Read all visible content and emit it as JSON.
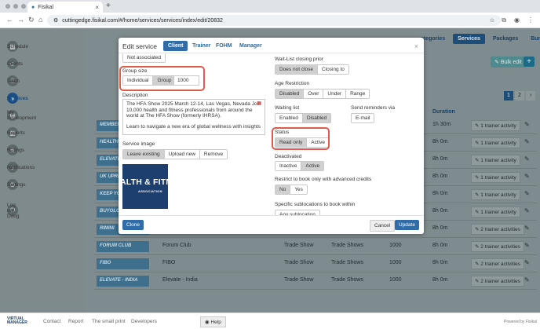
{
  "browser": {
    "tab_title": "Fisikal",
    "url": "cuttingedge.fisikal.com/#/home/services/services/index/edit/20832"
  },
  "sidebar": {
    "items": [
      {
        "label": "Schedule",
        "icon": "calendar-icon"
      },
      {
        "label": "Clients",
        "icon": "user-icon"
      },
      {
        "label": "Team",
        "icon": "team-icon"
      },
      {
        "label": "Services",
        "icon": "services-icon",
        "active": true
      },
      {
        "label": "My development",
        "icon": "development-icon"
      },
      {
        "label": "Reports",
        "icon": "reports-icon"
      },
      {
        "label": "Ratings",
        "icon": "star-icon"
      },
      {
        "label": "Notifications",
        "icon": "bell-icon"
      },
      {
        "label": "Settings",
        "icon": "gear-icon"
      },
      {
        "label": "Log out Doug",
        "icon": "logout-icon"
      }
    ]
  },
  "topnav": {
    "categories": "ategories",
    "services": "Services",
    "packages": "Packages",
    "bundles": "Bundles"
  },
  "toolbar": {
    "bulk_edit": "Bulk edit",
    "add": "+"
  },
  "pager": {
    "page1": "1",
    "page2": "2",
    "next": "›"
  },
  "table": {
    "duration_header": "Duration",
    "rows": [
      {
        "tag": "MEMBER",
        "type": "",
        "cat": "",
        "num": "",
        "duration": "1h 30m",
        "action": "1 trainer activity"
      },
      {
        "tag": "HEALTH",
        "type": "",
        "cat": "",
        "num": "",
        "duration": "8h 0m",
        "action": "1 trainer activity"
      },
      {
        "tag": "ELEVATE",
        "type": "",
        "cat": "",
        "num": "",
        "duration": "8h 0m",
        "action": "1 trainer activity"
      },
      {
        "tag": "UK UPRI",
        "type": "",
        "cat": "",
        "num": "",
        "duration": "8h 0m",
        "action": "1 trainer activity"
      },
      {
        "tag": "KEEP YO",
        "type": "",
        "cat": "",
        "num": "",
        "duration": "8h 0m",
        "action": "1 trainer activity"
      },
      {
        "tag": "BUYOLO",
        "type": "",
        "cat": "",
        "num": "",
        "duration": "8h 0m",
        "action": "1 trainer activity"
      },
      {
        "tag": "RIMINI",
        "type": "",
        "cat": "",
        "num": "",
        "duration": "8h 0m",
        "action": "2 trainer activities"
      },
      {
        "tag": "FORUM CLUB",
        "type": "Forum Club",
        "show": "Trade Show",
        "cat": "Trade Shows",
        "num": "1000",
        "duration": "8h 0m",
        "action": "2 trainer activities"
      },
      {
        "tag": "FIBO",
        "type": "FIBO",
        "show": "Trade Show",
        "cat": "Trade Shows",
        "num": "1000",
        "duration": "8h 0m",
        "action": "2 trainer activities"
      },
      {
        "tag": "ELEVATE - INDIA",
        "type": "Elevate - India",
        "show": "Trade Show",
        "cat": "Trade Shows",
        "num": "1000",
        "duration": "8h 0m",
        "action": "2 trainer activities"
      }
    ]
  },
  "footer": {
    "logo_line1": "VIRTUAL",
    "logo_line2": "MANAGER",
    "links": [
      "Contact",
      "Report",
      "The small print",
      "Developers"
    ],
    "help": "Help",
    "powered": "Powered by Fisikal"
  },
  "modal": {
    "title": "Edit service",
    "tabs": [
      "Client",
      "Trainer",
      "FOHM",
      "Manager"
    ],
    "not_associated": "Not associated",
    "group_size": {
      "label": "Group size",
      "options": [
        "Individual",
        "Group"
      ],
      "selected": "Group",
      "value": "1000"
    },
    "description": {
      "label": "Description",
      "text1": "The HFA Show 2025 March 12-14, Las Vegas, Nevada Join 10,000 health and fitness professionals from around the world at The HFA Show (formerly IHRSA).",
      "text2": "Learn to navigate a new era of global wellness with insights"
    },
    "service_image": {
      "label": "Service image",
      "options": [
        "Leave existing",
        "Upload new",
        "Remove"
      ],
      "selected": "Leave existing"
    },
    "image": {
      "big": "ALTH & FITN",
      "small": "ASSOCIATION"
    },
    "waitlist_closing": {
      "label": "Wait-List closing prior",
      "options": [
        "Does not close",
        "Closing to"
      ],
      "selected": "Does not close"
    },
    "age_restriction": {
      "label": "Age Restriction",
      "options": [
        "Disabled",
        "Over",
        "Under",
        "Range"
      ],
      "selected": "Disabled"
    },
    "waiting_list": {
      "label": "Waiting list",
      "options": [
        "Enabled",
        "Disabled"
      ],
      "selected": "Disabled"
    },
    "reminders": {
      "label": "Send reminders via",
      "options": [
        "E-mail"
      ]
    },
    "status": {
      "label": "Status",
      "options": [
        "Read only",
        "Active"
      ],
      "selected": "Read only"
    },
    "deactivated": {
      "label": "Deactivated",
      "options": [
        "Inactive",
        "Active"
      ],
      "selected": "Active"
    },
    "restrict_credits": {
      "label": "Restrict to book only with advanced credits",
      "options": [
        "No",
        "Yes"
      ],
      "selected": "No"
    },
    "sublocations": {
      "label": "Specific sublocations to book within",
      "option": "Any sublocation"
    },
    "buttons": {
      "clone": "Clone",
      "cancel": "Cancel",
      "update": "Update"
    },
    "close": "×"
  }
}
